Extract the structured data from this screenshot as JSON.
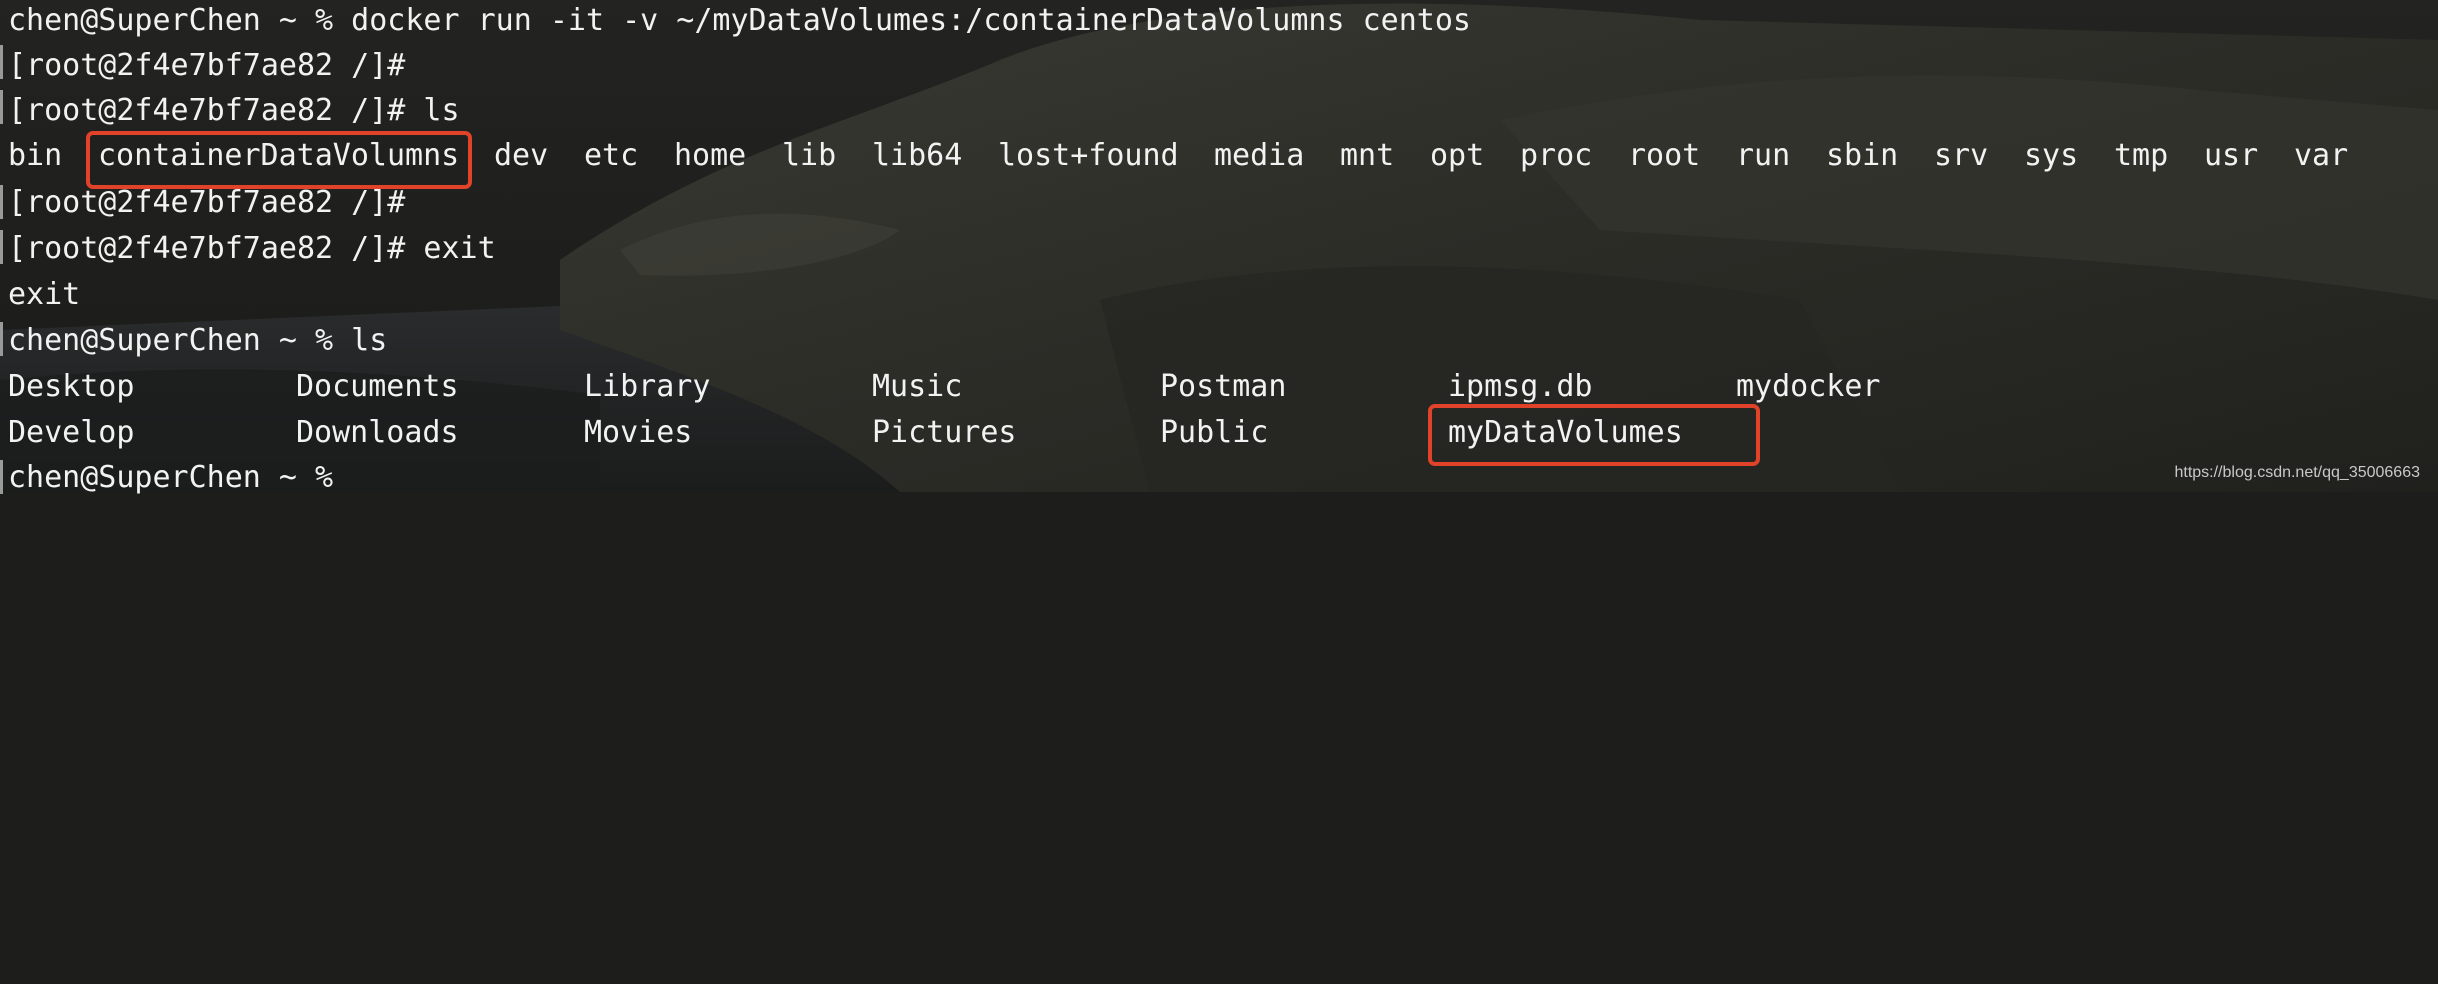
{
  "terminal": {
    "lines": [
      "chen@SuperChen ~ % docker run -it -v ~/myDataVolumes:/containerDataVolumns centos",
      "[root@2f4e7bf7ae82 /]#",
      "[root@2f4e7bf7ae82 /]# ls",
      "",
      "[root@2f4e7bf7ae82 /]#",
      "[root@2f4e7bf7ae82 /]# exit",
      "exit",
      "chen@SuperChen ~ % ls",
      "",
      "",
      "chen@SuperChen ~ %"
    ],
    "container_ls": [
      "bin",
      "containerDataVolumns",
      "dev",
      "etc",
      "home",
      "lib",
      "lib64",
      "lost+found",
      "media",
      "mnt",
      "opt",
      "proc",
      "root",
      "run",
      "sbin",
      "srv",
      "sys",
      "tmp",
      "usr",
      "var"
    ],
    "host_ls_row1": [
      "Desktop",
      "Documents",
      "Library",
      "Music",
      "Postman",
      "ipmsg.db",
      "mydocker"
    ],
    "host_ls_row2": [
      "Develop",
      "Downloads",
      "Movies",
      "Pictures",
      "Public",
      "myDataVolumes"
    ]
  },
  "highlight_color": "#e0422a",
  "watermark": "https://blog.csdn.net/qq_35006663"
}
